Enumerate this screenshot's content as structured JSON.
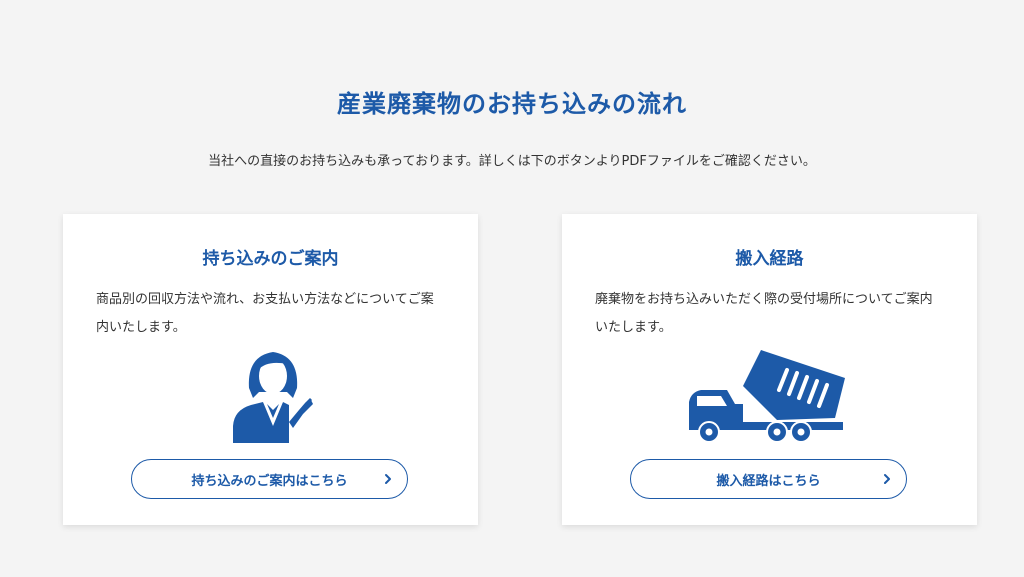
{
  "header": {
    "title": "産業廃棄物のお持ち込みの流れ",
    "lead": "当社への直接のお持ち込みも承っております。詳しくは下のボタンよりPDFファイルをご確認ください。"
  },
  "cards": [
    {
      "heading": "持ち込みのご案内",
      "text": "商品別の回収方法や流れ、お支払い方法などについてご案内いたします。",
      "icon": "businesswoman-icon",
      "button_label": "持ち込みのご案内はこちら"
    },
    {
      "heading": "搬入経路",
      "text": "廃棄物をお持ち込みいただく際の受付場所についてご案内いたします。",
      "icon": "dump-truck-icon",
      "button_label": "搬入経路はこちら"
    }
  ],
  "colors": {
    "accent": "#1d5aa8",
    "background": "#f4f4f4",
    "card": "#ffffff",
    "text": "#333333"
  }
}
